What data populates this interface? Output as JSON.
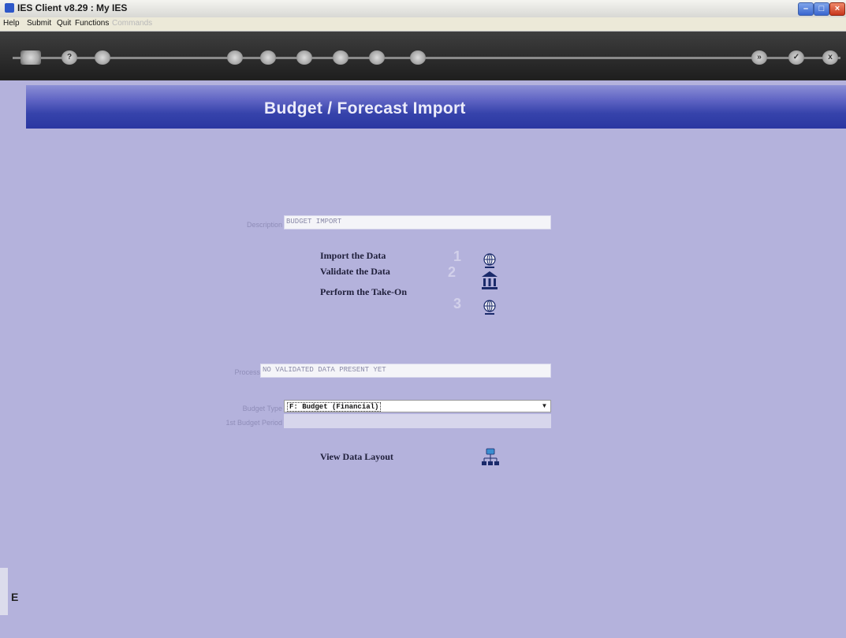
{
  "window": {
    "title": "IES Client v8.29 : My IES"
  },
  "menu": {
    "items": [
      "Help",
      "Submit",
      "Quit",
      "Functions",
      "Commands"
    ]
  },
  "toolbar": {
    "left_glyph": "?",
    "right_glyph_1": "»",
    "right_glyph_2": "✓",
    "right_glyph_3": "x"
  },
  "banner": {
    "title": "Budget / Forecast Import"
  },
  "form": {
    "description_label": "Description",
    "description_value": "BUDGET IMPORT",
    "steps": [
      {
        "label": "Import the Data",
        "num": "1",
        "icon": "globe-icon"
      },
      {
        "label": "Validate the Data",
        "num": "2",
        "icon": "bank-icon"
      },
      {
        "label": "Perform the Take-On",
        "num": "3",
        "icon": "globe-icon"
      }
    ],
    "process_status_label": "Process Status",
    "process_status_value": "NO VALIDATED DATA PRESENT YET",
    "budget_type_label": "Budget Type",
    "budget_type_value": "F: Budget (Financial)",
    "first_period_label": "1st Budget Period",
    "view_layout_label": "View Data Layout"
  },
  "footer": {
    "glyph": "E"
  },
  "colors": {
    "banner": "#2a37a1",
    "background": "#b4b2dc"
  }
}
